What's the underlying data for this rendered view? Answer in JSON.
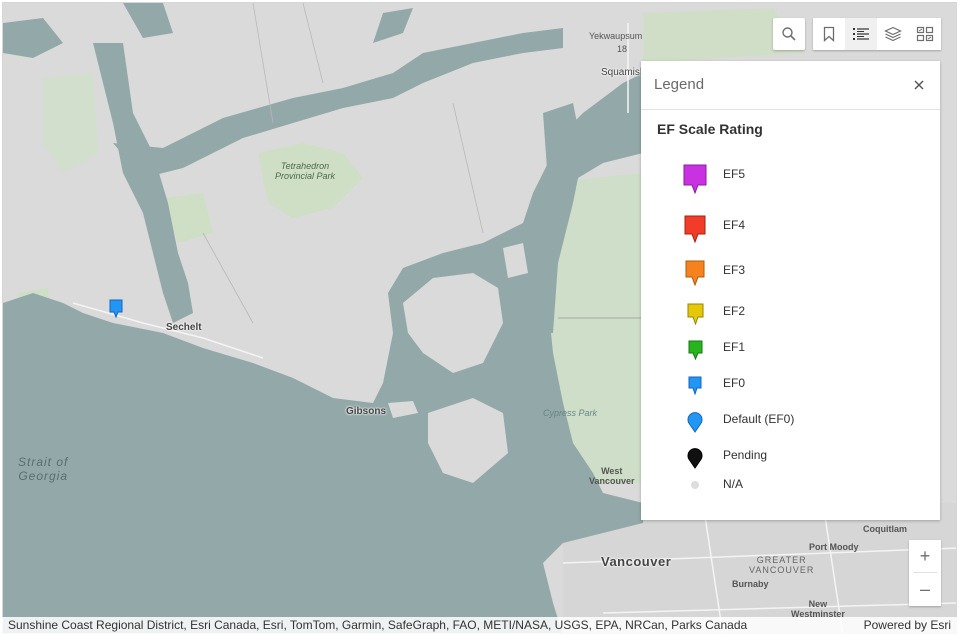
{
  "map": {
    "labels": {
      "yekwaupsum": "Yekwaupsum",
      "yekwaupsum_num": "18",
      "squamish": "Squamish",
      "tetrahedron": "Tetrahedron\nProvincial Park",
      "sechelt": "Sechelt",
      "gibsons": "Gibsons",
      "strait": "Strait of\nGeorgia",
      "cypress": "Cypress Park",
      "west_vancouver": "West\nVancouver",
      "vancouver": "Vancouver",
      "greater_vancouver": "GREATER\nVANCOUVER",
      "burnaby": "Burnaby",
      "port_moody": "Port Moody",
      "coquitlam": "Coquitlam",
      "new_westminster": "New\nWestminster"
    },
    "marker": {
      "icon": "marker-ef0-icon",
      "color": "#2196f3"
    }
  },
  "toolbar": {
    "search_icon": "search-icon",
    "bookmarks_icon": "bookmark-icon",
    "legend_icon": "legend-list-icon",
    "layers_icon": "layers-icon",
    "basemap_icon": "basemap-gallery-icon"
  },
  "legend": {
    "title": "Legend",
    "layer_title": "EF Scale Rating",
    "items": [
      {
        "label": "EF5",
        "color": "#c832e0"
      },
      {
        "label": "EF4",
        "color": "#f03c28"
      },
      {
        "label": "EF3",
        "color": "#f5821e"
      },
      {
        "label": "EF2",
        "color": "#e6c80a"
      },
      {
        "label": "EF1",
        "color": "#28b41e"
      },
      {
        "label": "EF0",
        "color": "#2196f3"
      },
      {
        "label": "Default (EF0)",
        "color": "#2196f3"
      },
      {
        "label": "Pending",
        "color": "#111111"
      },
      {
        "label": "N/A",
        "color": "#dddddd"
      }
    ]
  },
  "zoom": {
    "in_label": "+",
    "out_label": "–"
  },
  "attribution": {
    "sources": "Sunshine Coast Regional District, Esri Canada, Esri, TomTom, Garmin, SafeGraph, FAO, METI/NASA, USGS, EPA, NRCan, Parks Canada",
    "powered_by": "Powered by Esri"
  }
}
